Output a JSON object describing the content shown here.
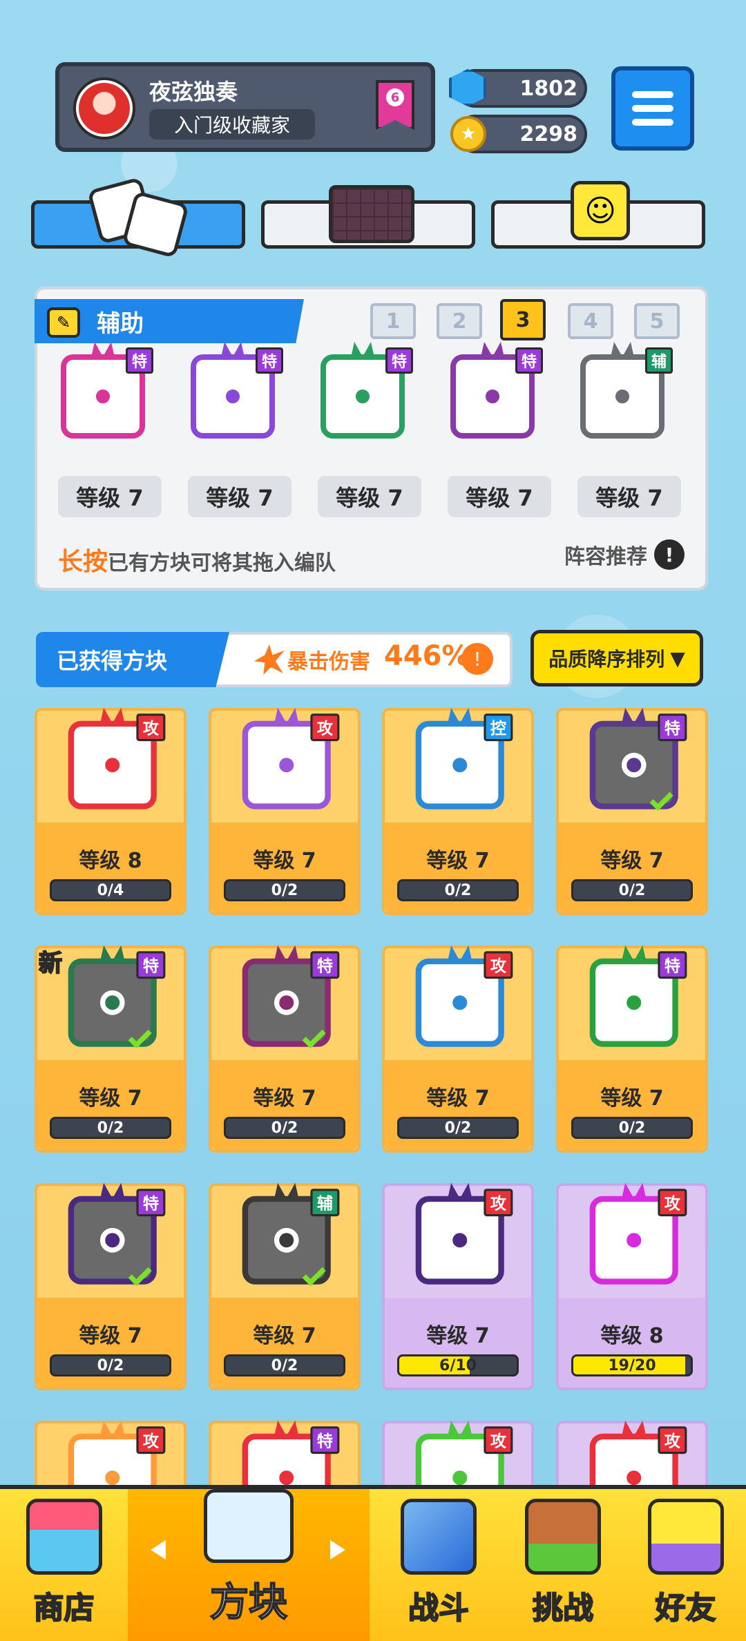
{
  "player": {
    "name": "夜弦独奏",
    "title": "入门级收藏家",
    "rank": "6"
  },
  "currency": {
    "gems": "1802",
    "coins": "2298"
  },
  "colors": {
    "accent_blue": "#1f87ea",
    "gold": "#ffc21a",
    "attack": "#e8313a",
    "special": "#9a3ad8",
    "control": "#1f9ae8",
    "support": "#1d9a6a"
  },
  "lineup": {
    "header": "辅助",
    "slots": [
      "1",
      "2",
      "3",
      "4",
      "5"
    ],
    "active_slot": "3",
    "dice": [
      {
        "tag": "特",
        "level": "等级 7",
        "color": "#d8349a"
      },
      {
        "tag": "特",
        "level": "等级 7",
        "color": "#8a48d8"
      },
      {
        "tag": "特",
        "level": "等级 7",
        "color": "#2aa060"
      },
      {
        "tag": "特",
        "level": "等级 7",
        "color": "#8a3aa8"
      },
      {
        "tag": "辅",
        "level": "等级 7",
        "color": "#6a6e74"
      }
    ],
    "hint_emphasis": "长按",
    "hint_text": "已有方块可将其拖入编队",
    "recommend": "阵容推荐"
  },
  "collection": {
    "title": "已获得方块",
    "crit_label": "暴击伤害",
    "crit_value": "446%",
    "sort_label": "品质降序排列"
  },
  "cards": [
    {
      "tag": "攻",
      "level": "等级 8",
      "progress": "0/4",
      "color": "#e8313a",
      "bg": "#fff",
      "fill": 0,
      "checked": false
    },
    {
      "tag": "攻",
      "level": "等级 7",
      "progress": "0/2",
      "color": "#9a58d8",
      "bg": "#fff",
      "fill": 0,
      "checked": false
    },
    {
      "tag": "控",
      "level": "等级 7",
      "progress": "0/2",
      "color": "#2a8ad8",
      "bg": "#fff",
      "fill": 0,
      "checked": false
    },
    {
      "tag": "特",
      "level": "等级 7",
      "progress": "0/2",
      "color": "#5a3a90",
      "bg": "#6a6a6a",
      "fill": 0,
      "checked": true
    },
    {
      "tag": "特",
      "level": "等级 7",
      "progress": "0/2",
      "color": "#2a7a50",
      "bg": "#6a6a6a",
      "fill": 0,
      "checked": true,
      "new": "新"
    },
    {
      "tag": "特",
      "level": "等级 7",
      "progress": "0/2",
      "color": "#8a2a70",
      "bg": "#6a6a6a",
      "fill": 0,
      "checked": true
    },
    {
      "tag": "攻",
      "level": "等级 7",
      "progress": "0/2",
      "color": "#2a8ad8",
      "bg": "#fff",
      "fill": 0,
      "checked": false
    },
    {
      "tag": "特",
      "level": "等级 7",
      "progress": "0/2",
      "color": "#2aa040",
      "bg": "#fff",
      "fill": 0,
      "checked": false
    },
    {
      "tag": "特",
      "level": "等级 7",
      "progress": "0/2",
      "color": "#4a2a80",
      "bg": "#6a6a6a",
      "fill": 0,
      "checked": true
    },
    {
      "tag": "辅",
      "level": "等级 7",
      "progress": "0/2",
      "color": "#3a3a3a",
      "bg": "#6a6a6a",
      "fill": 0,
      "checked": true
    },
    {
      "tag": "攻",
      "level": "等级 7",
      "progress": "6/10",
      "color": "#4a2a80",
      "bg": "#fff",
      "fill": 0.6,
      "checked": false,
      "epic": true
    },
    {
      "tag": "攻",
      "level": "等级 8",
      "progress": "19/20",
      "color": "#d82ae0",
      "bg": "#fff",
      "fill": 0.95,
      "checked": false,
      "epic": true
    },
    {
      "tag": "攻",
      "level": "",
      "progress": "",
      "color": "#ff9a3a",
      "bg": "#fff",
      "fill": 0,
      "checked": false
    },
    {
      "tag": "特",
      "level": "",
      "progress": "",
      "color": "#e8313a",
      "bg": "#fff",
      "fill": 0,
      "checked": false
    },
    {
      "tag": "攻",
      "level": "",
      "progress": "",
      "color": "#4ac83a",
      "bg": "#fff",
      "fill": 0,
      "checked": false,
      "epic": true
    },
    {
      "tag": "攻",
      "level": "",
      "progress": "",
      "color": "#e8313a",
      "bg": "#fff",
      "fill": 0,
      "checked": false,
      "epic": true
    }
  ],
  "nav": [
    {
      "label": "商店",
      "icon": "shop-icon"
    },
    {
      "label": "方块",
      "icon": "dice-icon",
      "active": true
    },
    {
      "label": "战斗",
      "icon": "battle-icon"
    },
    {
      "label": "挑战",
      "icon": "challenge-icon"
    },
    {
      "label": "好友",
      "icon": "friends-icon"
    }
  ]
}
